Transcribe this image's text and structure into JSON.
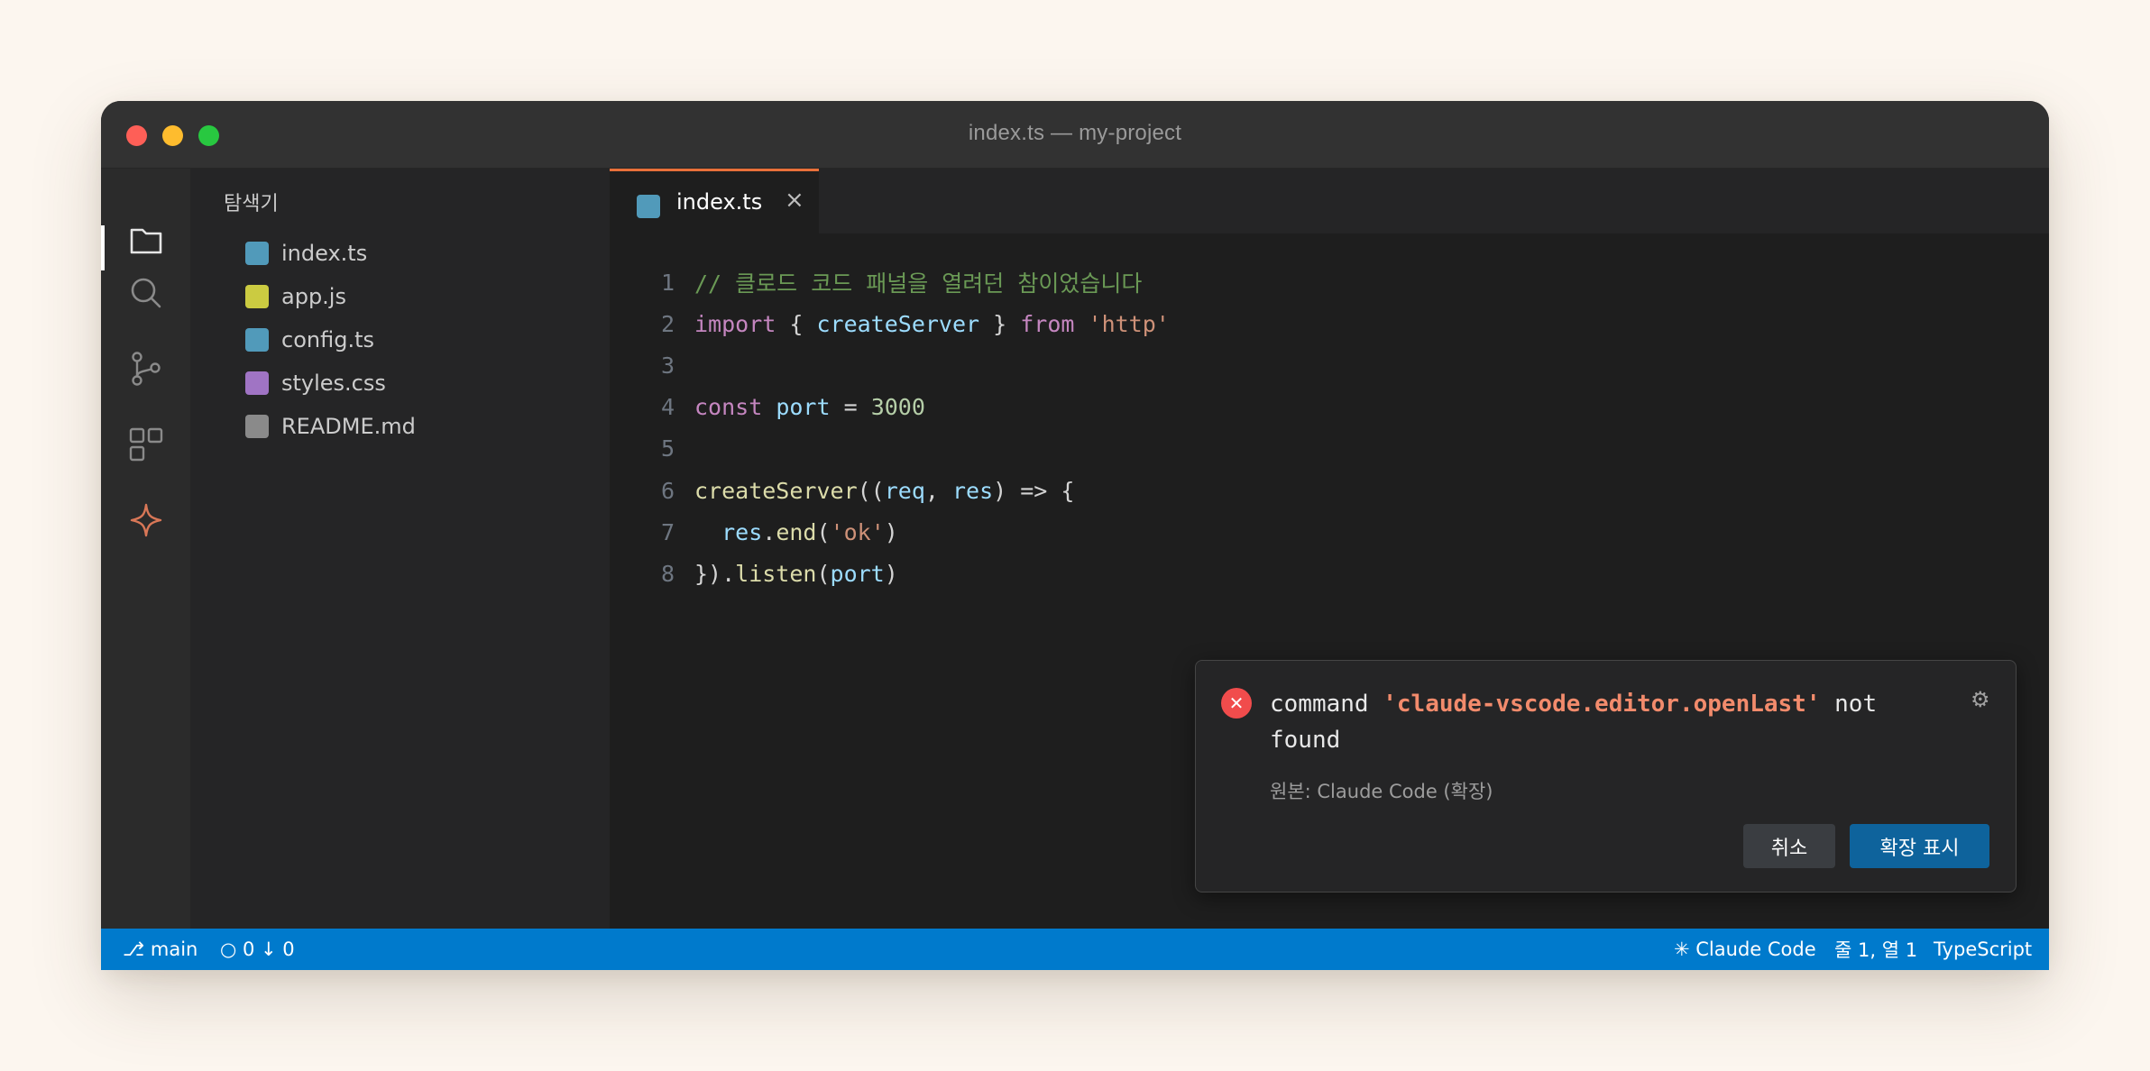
{
  "window": {
    "title": "index.ts — my-project"
  },
  "activitybar": {
    "items": [
      "explorer-icon",
      "search-icon",
      "source-control-icon",
      "extensions-icon",
      "claude-icon"
    ],
    "active": "explorer-icon"
  },
  "sidebar": {
    "title": "탐색기",
    "files": [
      {
        "name": "index.ts",
        "color": "#519aba"
      },
      {
        "name": "app.js",
        "color": "#cbcb41"
      },
      {
        "name": "config.ts",
        "color": "#519aba"
      },
      {
        "name": "styles.css",
        "color": "#a074c4"
      },
      {
        "name": "README.md",
        "color": "#8a8a8a"
      }
    ]
  },
  "editor": {
    "tab": {
      "label": "index.ts",
      "close": "×",
      "accent": "#e8703a"
    },
    "lines": [
      {
        "n": "1",
        "parts": [
          [
            "c-comment",
            "// 클로드 코드 패널을 열려던 참이었습니다"
          ]
        ]
      },
      {
        "n": "2",
        "parts": [
          [
            "c-kw",
            "import"
          ],
          [
            "c-plain",
            " { "
          ],
          [
            "c-var",
            "createServer"
          ],
          [
            "c-plain",
            " } "
          ],
          [
            "c-kw",
            "from"
          ],
          [
            "c-plain",
            " "
          ],
          [
            "c-str",
            "'http'"
          ]
        ]
      },
      {
        "n": "3",
        "parts": []
      },
      {
        "n": "4",
        "parts": [
          [
            "c-kw",
            "const"
          ],
          [
            "c-plain",
            " "
          ],
          [
            "c-var",
            "port"
          ],
          [
            "c-plain",
            " = "
          ],
          [
            "c-num",
            "3000"
          ]
        ]
      },
      {
        "n": "5",
        "parts": []
      },
      {
        "n": "6",
        "parts": [
          [
            "c-fn",
            "createServer"
          ],
          [
            "c-plain",
            "(("
          ],
          [
            "c-var",
            "req"
          ],
          [
            "c-plain",
            ", "
          ],
          [
            "c-var",
            "res"
          ],
          [
            "c-plain",
            ") => {"
          ]
        ]
      },
      {
        "n": "7",
        "parts": [
          [
            "c-plain",
            "  "
          ],
          [
            "c-var",
            "res"
          ],
          [
            "c-plain",
            "."
          ],
          [
            "c-fn",
            "end"
          ],
          [
            "c-plain",
            "("
          ],
          [
            "c-str",
            "'ok'"
          ],
          [
            "c-plain",
            ")"
          ]
        ]
      },
      {
        "n": "8",
        "parts": [
          [
            "c-plain",
            "})."
          ],
          [
            "c-fn",
            "listen"
          ],
          [
            "c-plain",
            "("
          ],
          [
            "c-var",
            "port"
          ],
          [
            "c-plain",
            ")"
          ]
        ]
      }
    ]
  },
  "notification": {
    "icon": "error-icon",
    "message_prefix": "command ",
    "message_command": "'claude-vscode.editor.openLast'",
    "message_suffix": " not found",
    "source": "원본: Claude Code (확장)",
    "settings_icon": "⚙",
    "cancel_label": "취소",
    "show_label": "확장 표시"
  },
  "statusbar": {
    "branch": "⎇ main",
    "sync": "○ 0 ↓ 0",
    "claude": "✳ Claude Code",
    "position": "줄 1, 열 1",
    "language": "TypeScript",
    "color": "#007acc"
  }
}
